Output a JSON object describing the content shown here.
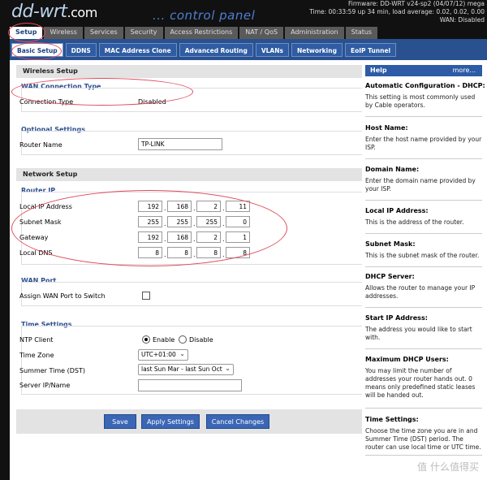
{
  "header": {
    "logo_main": "dd-wrt",
    "logo_dot": ".com",
    "panel_text": "... control panel",
    "firmware": "Firmware: DD-WRT v24-sp2 (04/07/12) mega",
    "time": "Time: 00:33:59 up 34 min, load average: 0.02, 0.02, 0.00",
    "wan": "WAN: Disabled"
  },
  "main_tabs": [
    "Setup",
    "Wireless",
    "Services",
    "Security",
    "Access Restrictions",
    "NAT / QoS",
    "Administration",
    "Status"
  ],
  "sub_tabs": [
    "Basic Setup",
    "DDNS",
    "MAC Address Clone",
    "Advanced Routing",
    "VLANs",
    "Networking",
    "EoIP Tunnel"
  ],
  "wireless_setup": {
    "heading": "Wireless Setup",
    "wan_legend": "WAN Connection Type",
    "connection_type_label": "Connection Type",
    "connection_type_value": "Disabled",
    "optional_legend": "Optional Settings",
    "router_name_label": "Router Name",
    "router_name_value": "TP-LINK"
  },
  "network_setup": {
    "heading": "Network Setup",
    "router_ip_legend": "Router IP",
    "local_ip_label": "Local IP Address",
    "local_ip": [
      "192",
      "168",
      "2",
      "11"
    ],
    "subnet_label": "Subnet Mask",
    "subnet": [
      "255",
      "255",
      "255",
      "0"
    ],
    "gateway_label": "Gateway",
    "gateway": [
      "192",
      "168",
      "2",
      "1"
    ],
    "dns_label": "Local DNS",
    "dns": [
      "8",
      "8",
      "8",
      "8"
    ],
    "wan_port_legend": "WAN Port",
    "assign_wan_label": "Assign WAN Port to Switch"
  },
  "time_settings": {
    "legend": "Time Settings",
    "ntp_label": "NTP Client",
    "enable": "Enable",
    "disable": "Disable",
    "tz_label": "Time Zone",
    "tz_value": "UTC+01:00",
    "dst_label": "Summer Time (DST)",
    "dst_value": "last Sun Mar - last Sun Oct",
    "server_label": "Server IP/Name",
    "server_value": ""
  },
  "buttons": {
    "save": "Save",
    "apply": "Apply Settings",
    "cancel": "Cancel Changes"
  },
  "help": {
    "title": "Help",
    "more": "more...",
    "items": [
      {
        "title": "Automatic Configuration - DHCP:",
        "text": "This setting is most commonly used by Cable operators."
      },
      {
        "title": "Host Name:",
        "text": "Enter the host name provided by your ISP."
      },
      {
        "title": "Domain Name:",
        "text": "Enter the domain name provided by your ISP."
      },
      {
        "title": "Local IP Address:",
        "text": "This is the address of the router."
      },
      {
        "title": "Subnet Mask:",
        "text": "This is the subnet mask of the router."
      },
      {
        "title": "DHCP Server:",
        "text": "Allows the router to manage your IP addresses."
      },
      {
        "title": "Start IP Address:",
        "text": "The address you would like to start with."
      },
      {
        "title": "Maximum DHCP Users:",
        "text": "You may limit the number of addresses your router hands out. 0 means only predefined static leases will be handed out."
      },
      {
        "title": "Time Settings:",
        "text": "Choose the time zone you are in and Summer Time (DST) period. The router can use local time or UTC time."
      }
    ]
  },
  "watermark": "值 什么值得买",
  "colors": {
    "accent": "#29518f",
    "annotation": "#e04a5a"
  }
}
